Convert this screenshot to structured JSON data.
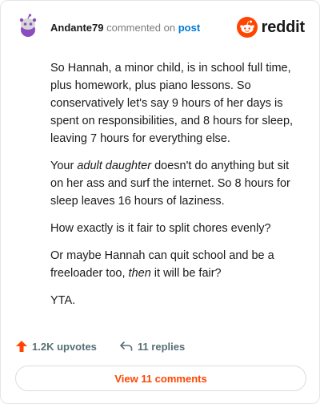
{
  "header": {
    "username": "Andante79",
    "action_text": "commented on",
    "post_link": "post",
    "logo_text": "reddit"
  },
  "comment": {
    "p1": "So Hannah, a minor child, is in school full time, plus homework, plus piano lessons. So conservatively let's say 9 hours of her days is spent on responsibilities, and 8 hours for sleep, leaving 7 hours for everything else.",
    "p2_pre": "Your ",
    "p2_em": "adult daughter",
    "p2_post": " doesn't do anything but sit on her ass and surf the internet. So 8 hours for sleep leaves 16 hours of laziness.",
    "p3": "How exactly is it fair to split chores evenly?",
    "p4_pre": "Or maybe Hannah can quit school and be a freeloader too, ",
    "p4_em": "then",
    "p4_post": " it will be fair?",
    "p5": "YTA."
  },
  "footer": {
    "upvotes": "1.2K upvotes",
    "replies": "11 replies",
    "view_comments": "View 11 comments"
  },
  "colors": {
    "brand": "#ff4500",
    "link": "#0079d3",
    "muted": "#7c7c7c",
    "avatar": "#8a4dbf"
  },
  "icons": [
    "avatar-snoo-icon",
    "reddit-logo-icon",
    "upvote-arrow-icon",
    "reply-arrow-icon"
  ]
}
